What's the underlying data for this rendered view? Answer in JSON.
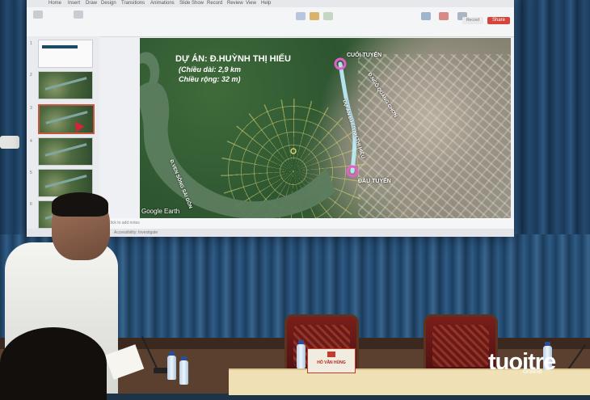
{
  "ribbon": {
    "tabs": [
      "Home",
      "Insert",
      "Draw",
      "Design",
      "Transitions",
      "Animations",
      "Slide Show",
      "Record",
      "Review",
      "View",
      "Help"
    ],
    "share_label": "Share",
    "record_label": "Record"
  },
  "panel": {
    "slide_numbers": [
      "1",
      "2",
      "3",
      "4",
      "5",
      "6"
    ]
  },
  "notes_text": "Click to add notes",
  "status_text": "Accessibility: Investigate",
  "slide": {
    "title": "DỰ ÁN: Đ.HUỲNH THỊ HIẾU",
    "length": "(Chiều dài: 2,9 km",
    "width": "Chiều rộng: 32 m)",
    "end_label": "CUỐI TUYẾN",
    "start_label": "ĐẦU TUYẾN",
    "route_label": "DỰ ÁN Đ.HUỲNH THỊ HIẾU",
    "road_label": "Đ.NGÔ QUANG CHƠN",
    "river_road_label": "Đ.VEN SÔNG SÀI GÒN",
    "google_earth": "Google Earth",
    "route_color": "#bff0ff",
    "marker_color": "#e061c8"
  },
  "room": {
    "nameplate_name": "HỒ VĂN HÙNG",
    "watermark_main": "tuoitre",
    "watermark_sub": "online"
  }
}
